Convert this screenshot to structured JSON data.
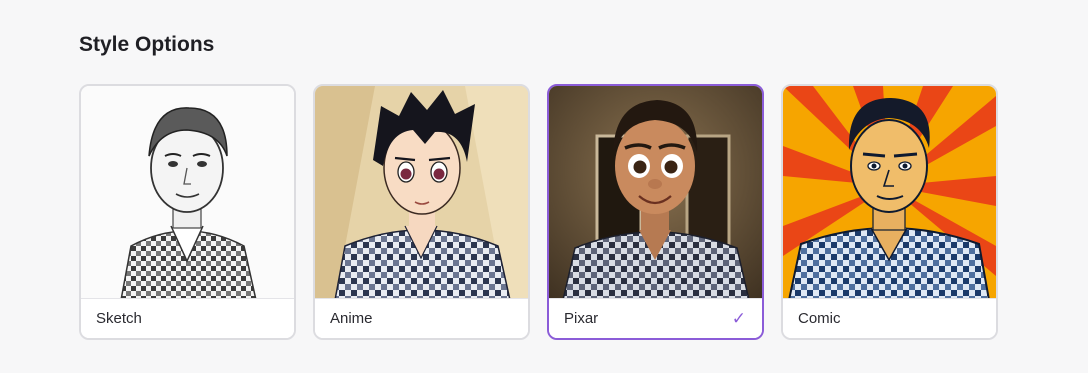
{
  "section": {
    "title": "Style Options"
  },
  "styles": [
    {
      "label": "Sketch",
      "selected": false
    },
    {
      "label": "Anime",
      "selected": false
    },
    {
      "label": "Pixar",
      "selected": true,
      "check": "✓"
    },
    {
      "label": "Comic",
      "selected": false
    }
  ],
  "colors": {
    "accent": "#8b5cd8",
    "card_border": "#dcdce0",
    "background": "#f7f7f8"
  }
}
